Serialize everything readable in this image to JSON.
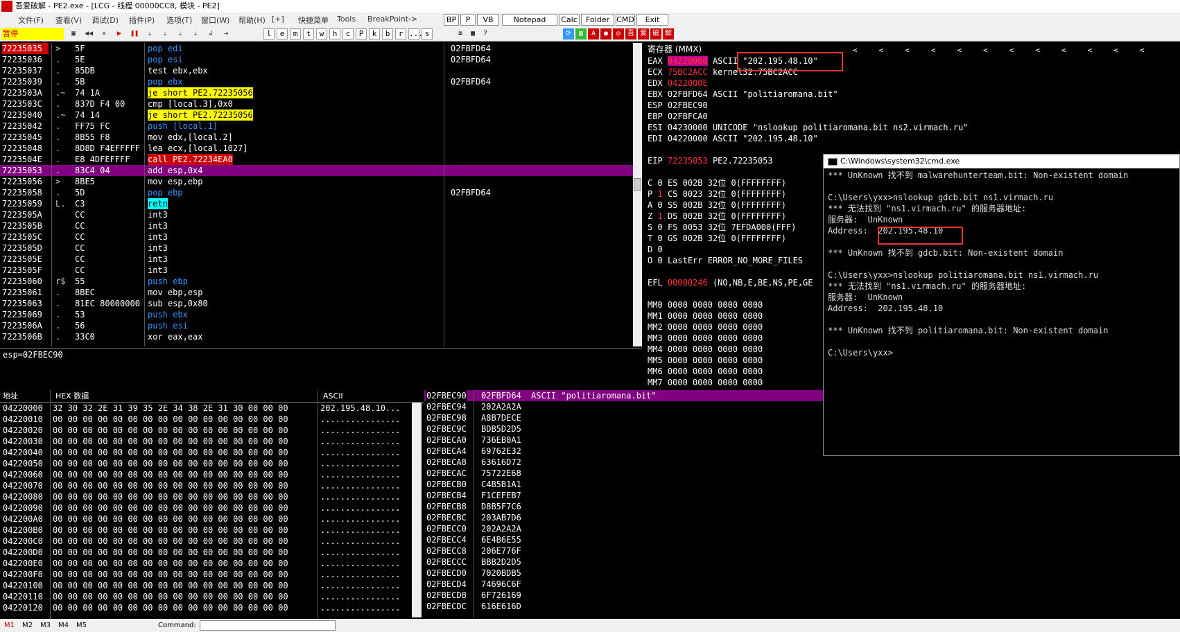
{
  "window": {
    "title": "吾爱破解 - PE2.exe - [LCG - 线程 00000CC8, 模块 - PE2]",
    "logo": "吾爱破解"
  },
  "menu": {
    "items": [
      "文件(F)",
      "查看(V)",
      "调试(D)",
      "插件(P)",
      "选项(T)",
      "窗口(W)",
      "帮助(H)",
      "[+]",
      "快捷菜单",
      "Tools",
      "BreakPoint->"
    ],
    "buttons": [
      "BP",
      "P",
      "VB",
      "Notepad",
      "Calc",
      "Folder",
      "CMD",
      "Exit"
    ]
  },
  "toolbar": {
    "status": "暂停",
    "letters": [
      "l",
      "e",
      "m",
      "t",
      "w",
      "h",
      "c",
      "P",
      "k",
      "b",
      "r",
      "...",
      "s"
    ],
    "cn": [
      "吾",
      "爱",
      "破",
      "解"
    ]
  },
  "disasm": {
    "rows": [
      {
        "addr": "72235035",
        "mk": ">",
        "hex": "5F",
        "asm": "pop edi",
        "cmt": "02FBFD64",
        "hlAddr": true
      },
      {
        "addr": "72235036",
        "mk": ".",
        "hex": "5E",
        "asm": "pop esi",
        "cmt": "02FBFD64"
      },
      {
        "addr": "72235037",
        "mk": ".",
        "hex": "85DB",
        "asm": "test ebx,ebx",
        "cmt": ""
      },
      {
        "addr": "72235039",
        "mk": ".",
        "hex": "5B",
        "asm": "pop ebx",
        "cmt": "02FBFD64"
      },
      {
        "addr": "7223503A",
        "mk": ".~",
        "hex": "74 1A",
        "asm": "je short PE2.72235056",
        "cmt": ""
      },
      {
        "addr": "7223503C",
        "mk": ".",
        "hex": "837D F4 00",
        "asm": "cmp [local.3],0x0",
        "cmt": ""
      },
      {
        "addr": "72235040",
        "mk": ".~",
        "hex": "74 14",
        "asm": "je short PE2.72235056",
        "cmt": ""
      },
      {
        "addr": "72235042",
        "mk": ".",
        "hex": "FF75 FC",
        "asm": "push [local.1]",
        "cmt": ""
      },
      {
        "addr": "72235045",
        "mk": ".",
        "hex": "8B55 F8",
        "asm": "mov edx,[local.2]",
        "cmt": ""
      },
      {
        "addr": "72235048",
        "mk": ".",
        "hex": "8D8D F4EFFFFF",
        "asm": "lea ecx,[local.1027]",
        "cmt": ""
      },
      {
        "addr": "7223504E",
        "mk": ".",
        "hex": "E8 4DFEFFFF",
        "asm": "call PE2.72234EA0",
        "cmt": ""
      },
      {
        "addr": "72235053",
        "mk": ".",
        "hex": "83C4 04",
        "asm": "add esp,0x4",
        "cmt": "",
        "sel": true
      },
      {
        "addr": "72235056",
        "mk": ">",
        "hex": "8BE5",
        "asm": "mov esp,ebp",
        "cmt": ""
      },
      {
        "addr": "72235058",
        "mk": ".",
        "hex": "5D",
        "asm": "pop ebp",
        "cmt": "02FBFD64"
      },
      {
        "addr": "72235059",
        "mk": "L.",
        "hex": "C3",
        "asm": "retn",
        "cmt": ""
      },
      {
        "addr": "7223505A",
        "mk": "",
        "hex": "CC",
        "asm": "int3",
        "cmt": ""
      },
      {
        "addr": "7223505B",
        "mk": "",
        "hex": "CC",
        "asm": "int3",
        "cmt": ""
      },
      {
        "addr": "7223505C",
        "mk": "",
        "hex": "CC",
        "asm": "int3",
        "cmt": ""
      },
      {
        "addr": "7223505D",
        "mk": "",
        "hex": "CC",
        "asm": "int3",
        "cmt": ""
      },
      {
        "addr": "7223505E",
        "mk": "",
        "hex": "CC",
        "asm": "int3",
        "cmt": ""
      },
      {
        "addr": "7223505F",
        "mk": "",
        "hex": "CC",
        "asm": "int3",
        "cmt": ""
      },
      {
        "addr": "72235060",
        "mk": "r$",
        "hex": "55",
        "asm": "push ebp",
        "cmt": ""
      },
      {
        "addr": "72235061",
        "mk": ".",
        "hex": "8BEC",
        "asm": "mov ebp,esp",
        "cmt": ""
      },
      {
        "addr": "72235063",
        "mk": ".",
        "hex": "81EC 80000000",
        "asm": "sub esp,0x80",
        "cmt": ""
      },
      {
        "addr": "72235069",
        "mk": ".",
        "hex": "53",
        "asm": "push ebx",
        "cmt": ""
      },
      {
        "addr": "7223506A",
        "mk": ".",
        "hex": "56",
        "asm": "push esi",
        "cmt": ""
      },
      {
        "addr": "7223506B",
        "mk": ".",
        "hex": "33C0",
        "asm": "xor eax,eax",
        "cmt": ""
      }
    ]
  },
  "info": {
    "line": "esp=02FBEC90"
  },
  "registers": {
    "header": "寄存器 (MMX)",
    "gp": [
      {
        "name": "EAX",
        "val": "04220000",
        "desc": "ASCII \"202.195.48.10\"",
        "red": true
      },
      {
        "name": "ECX",
        "val": "75BC2ACC",
        "desc": "kernel32.75BC2ACC",
        "red": true
      },
      {
        "name": "EDX",
        "val": "0422000E",
        "desc": "",
        "red": true
      },
      {
        "name": "EBX",
        "val": "02FBFD64",
        "desc": "ASCII \"politiaromana.bit\""
      },
      {
        "name": "ESP",
        "val": "02FBEC90",
        "desc": ""
      },
      {
        "name": "EBP",
        "val": "02FBFCA0",
        "desc": ""
      },
      {
        "name": "ESI",
        "val": "04230000",
        "desc": "UNICODE \"nslookup politiaromana.bit ns2.virmach.ru\""
      },
      {
        "name": "EDI",
        "val": "04220000",
        "desc": "ASCII \"202.195.48.10\""
      }
    ],
    "eip": {
      "name": "EIP",
      "val": "72235053",
      "desc": "PE2.72235053"
    },
    "flags": [
      {
        "f": "C",
        "v": "0",
        "seg": "ES",
        "sv": "002B",
        "bits": "32位",
        "range": "0(FFFFFFFF)"
      },
      {
        "f": "P",
        "v": "1",
        "seg": "CS",
        "sv": "0023",
        "bits": "32位",
        "range": "0(FFFFFFFF)",
        "red": true
      },
      {
        "f": "A",
        "v": "0",
        "seg": "SS",
        "sv": "002B",
        "bits": "32位",
        "range": "0(FFFFFFFF)"
      },
      {
        "f": "Z",
        "v": "1",
        "seg": "DS",
        "sv": "002B",
        "bits": "32位",
        "range": "0(FFFFFFFF)",
        "red": true
      },
      {
        "f": "S",
        "v": "0",
        "seg": "FS",
        "sv": "0053",
        "bits": "32位",
        "range": "7EFDA000(FFF)"
      },
      {
        "f": "T",
        "v": "0",
        "seg": "GS",
        "sv": "002B",
        "bits": "32位",
        "range": "0(FFFFFFFF)"
      },
      {
        "f": "D",
        "v": "0",
        "seg": "",
        "sv": "",
        "bits": "",
        "range": ""
      },
      {
        "f": "O",
        "v": "0",
        "seg": "LastErr",
        "sv": "ERROR_NO_MORE_FILES",
        "bits": "",
        "range": ""
      }
    ],
    "efl": {
      "name": "EFL",
      "val": "00000246",
      "desc": "(NO,NB,E,BE,NS,PE,GE"
    },
    "mmx": [
      "MM0 0000 0000 0000 0000",
      "MM1 0000 0000 0000 0000",
      "MM2 0000 0000 0000 0000",
      "MM3 0000 0000 0000 0000",
      "MM4 0000 0000 0000 0000",
      "MM5 0000 0000 0000 0000",
      "MM6 0000 0000 0000 0000",
      "MM7 0000 0000 0000 0000"
    ]
  },
  "dump": {
    "h_addr": "地址",
    "h_hex": "HEX 数据",
    "h_ascii": "ASCII",
    "rows": [
      {
        "a": "04220000",
        "h": "32 30 32 2E 31 39 35 2E 34 38 2E 31 30 00 00 00",
        "s": "202.195.48.10..."
      },
      {
        "a": "04220010",
        "h": "00 00 00 00 00 00 00 00 00 00 00 00 00 00 00 00",
        "s": "................"
      },
      {
        "a": "04220020",
        "h": "00 00 00 00 00 00 00 00 00 00 00 00 00 00 00 00",
        "s": "................"
      },
      {
        "a": "04220030",
        "h": "00 00 00 00 00 00 00 00 00 00 00 00 00 00 00 00",
        "s": "................"
      },
      {
        "a": "04220040",
        "h": "00 00 00 00 00 00 00 00 00 00 00 00 00 00 00 00",
        "s": "................"
      },
      {
        "a": "04220050",
        "h": "00 00 00 00 00 00 00 00 00 00 00 00 00 00 00 00",
        "s": "................"
      },
      {
        "a": "04220060",
        "h": "00 00 00 00 00 00 00 00 00 00 00 00 00 00 00 00",
        "s": "................"
      },
      {
        "a": "04220070",
        "h": "00 00 00 00 00 00 00 00 00 00 00 00 00 00 00 00",
        "s": "................"
      },
      {
        "a": "04220080",
        "h": "00 00 00 00 00 00 00 00 00 00 00 00 00 00 00 00",
        "s": "................"
      },
      {
        "a": "04220090",
        "h": "00 00 00 00 00 00 00 00 00 00 00 00 00 00 00 00",
        "s": "................"
      },
      {
        "a": "042200A0",
        "h": "00 00 00 00 00 00 00 00 00 00 00 00 00 00 00 00",
        "s": "................"
      },
      {
        "a": "042200B0",
        "h": "00 00 00 00 00 00 00 00 00 00 00 00 00 00 00 00",
        "s": "................"
      },
      {
        "a": "042200C0",
        "h": "00 00 00 00 00 00 00 00 00 00 00 00 00 00 00 00",
        "s": "................"
      },
      {
        "a": "042200D0",
        "h": "00 00 00 00 00 00 00 00 00 00 00 00 00 00 00 00",
        "s": "................"
      },
      {
        "a": "042200E0",
        "h": "00 00 00 00 00 00 00 00 00 00 00 00 00 00 00 00",
        "s": "................"
      },
      {
        "a": "042200F0",
        "h": "00 00 00 00 00 00 00 00 00 00 00 00 00 00 00 00",
        "s": "................"
      },
      {
        "a": "04220100",
        "h": "00 00 00 00 00 00 00 00 00 00 00 00 00 00 00 00",
        "s": "................"
      },
      {
        "a": "04220110",
        "h": "00 00 00 00 00 00 00 00 00 00 00 00 00 00 00 00",
        "s": "................"
      },
      {
        "a": "04220120",
        "h": "00 00 00 00 00 00 00 00 00 00 00 00 00 00 00 00",
        "s": "................"
      }
    ]
  },
  "stack": {
    "rows": [
      {
        "a": "02FBEC90",
        "v": "02FBFD64",
        "c": "ASCII \"politiaromana.bit\"",
        "sel": true
      },
      {
        "a": "02FBEC94",
        "v": "202A2A2A",
        "c": ""
      },
      {
        "a": "02FBEC98",
        "v": "A8B7DECE",
        "c": ""
      },
      {
        "a": "02FBEC9C",
        "v": "BDB5D2D5",
        "c": ""
      },
      {
        "a": "02FBECA0",
        "v": "736EB0A1",
        "c": ""
      },
      {
        "a": "02FBECA4",
        "v": "69762E32",
        "c": ""
      },
      {
        "a": "02FBECA8",
        "v": "63616D72",
        "c": ""
      },
      {
        "a": "02FBECAC",
        "v": "75722E68",
        "c": ""
      },
      {
        "a": "02FBECB0",
        "v": "C4B5B1A1",
        "c": ""
      },
      {
        "a": "02FBECB4",
        "v": "F1CEFEB7",
        "c": ""
      },
      {
        "a": "02FBECB8",
        "v": "D8B5F7C6",
        "c": ""
      },
      {
        "a": "02FBECBC",
        "v": "203AB7D6",
        "c": ""
      },
      {
        "a": "02FBECC0",
        "v": "202A2A2A",
        "c": ""
      },
      {
        "a": "02FBECC4",
        "v": "6E4B6E55",
        "c": ""
      },
      {
        "a": "02FBECC8",
        "v": "206E776F",
        "c": ""
      },
      {
        "a": "02FBECCC",
        "v": "BBB2D2D5",
        "c": ""
      },
      {
        "a": "02FBECD0",
        "v": "7020BDB5",
        "c": ""
      },
      {
        "a": "02FBECD4",
        "v": "74696C6F",
        "c": ""
      },
      {
        "a": "02FBECD8",
        "v": "6F726169",
        "c": ""
      },
      {
        "a": "02FBECDC",
        "v": "616E616D",
        "c": ""
      }
    ]
  },
  "cmd": {
    "title": "C:\\Windows\\system32\\cmd.exe",
    "lines": [
      "*** UnKnown 找不到 malwarehunterteam.bit: Non-existent domain",
      "",
      "C:\\Users\\yxx>nslookup gdcb.bit ns1.virmach.ru",
      "*** 无法找到 \"ns1.virmach.ru\" 的服务器地址:",
      "服务器:  UnKnown",
      "Address:  202.195.48.10",
      "",
      "*** UnKnown 找不到 gdcb.bit: Non-existent domain",
      "",
      "C:\\Users\\yxx>nslookup politiaromana.bit ns1.virmach.ru",
      "*** 无法找到 \"ns1.virmach.ru\" 的服务器地址:",
      "服务器:  UnKnown",
      "Address:  202.195.48.10",
      "",
      "*** UnKnown 找不到 politiaromana.bit: Non-existent domain",
      "",
      "C:\\Users\\yxx>"
    ]
  },
  "status": {
    "tabs": [
      "M1",
      "M2",
      "M3",
      "M4",
      "M5"
    ],
    "command_label": "Command:"
  }
}
